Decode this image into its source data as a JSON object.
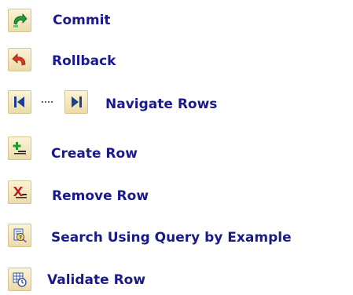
{
  "legend": {
    "items": [
      {
        "icon": "commit-icon",
        "label": "Commit"
      },
      {
        "icon": "rollback-icon",
        "label": "Rollback"
      },
      {
        "icon": "first-record-icon",
        "icon2": "last-record-icon",
        "label": "Navigate Rows"
      },
      {
        "icon": "create-row-icon",
        "label": "Create Row"
      },
      {
        "icon": "remove-row-icon",
        "label": "Remove Row"
      },
      {
        "icon": "query-by-example-icon",
        "label": "Search Using Query by Example"
      },
      {
        "icon": "validate-row-icon",
        "label": "Validate Row"
      }
    ]
  },
  "colors": {
    "label_text": "#1a1a8c",
    "button_face": "#f5e9c4",
    "nav_icon": "#1d3f8f",
    "commit_green": "#1e9a3b",
    "rollback_red": "#d23b1f"
  }
}
